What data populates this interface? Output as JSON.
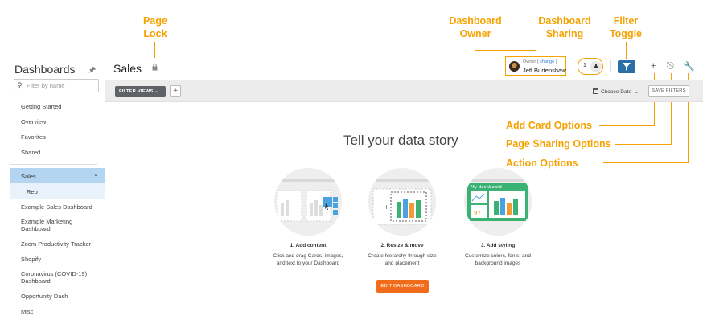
{
  "callouts": {
    "page_lock": "Page\nLock",
    "dashboard_owner": "Dashboard\nOwner",
    "dashboard_sharing": "Dashboard\nSharing",
    "filter_toggle": "Filter\nToggle",
    "add_card_options": "Add Card Options",
    "page_sharing_options": "Page Sharing Options",
    "action_options": "Action Options"
  },
  "sidebar": {
    "title": "Dashboards",
    "search_placeholder": "Filter by name",
    "items": [
      "Getting Started",
      "Overview",
      "Favorites",
      "Shared"
    ],
    "selected": "Sales",
    "selected_child": "Rep",
    "more_items": [
      "Example Sales Dashboard",
      "Example Marketing\nDashboard",
      "Zoom Productivity Tracker",
      "Shopify",
      "Coronavirus (COVID-19)\nDashboard",
      "Opportunity Dash",
      "Misc"
    ]
  },
  "header": {
    "page_title": "Sales",
    "owner_label": "Owner",
    "owner_change": "change",
    "owner_name": "Jeff Burtenshaw",
    "share_count": "1"
  },
  "filter_bar": {
    "filter_views_label": "FILTER VIEWS",
    "add_label": "+",
    "date_label": "Choose Date",
    "save_filters_label": "SAVE FILTERS"
  },
  "main": {
    "headline": "Tell your data story",
    "steps": [
      {
        "title": "1. Add content",
        "desc": "Click and drag Cards, images,\nand text to your Dashboard"
      },
      {
        "title": "2. Resize & move",
        "desc": "Create hierarchy through size\nand placement"
      },
      {
        "title": "3. Add styling",
        "desc": "Customize colors, fonts, and\nbackground images"
      }
    ],
    "styling_card_title": "My dashboard",
    "styling_card_number": "97",
    "edit_button": "EDIT DASHBOARD"
  },
  "colors": {
    "callout": "#f5a200",
    "primary_blue": "#2c6ea8",
    "selected_row": "#b3d5f2",
    "edit_button": "#f16c1a",
    "bar_green": "#3bb273",
    "bar_blue": "#4aa3df",
    "bar_orange": "#f39c35"
  }
}
